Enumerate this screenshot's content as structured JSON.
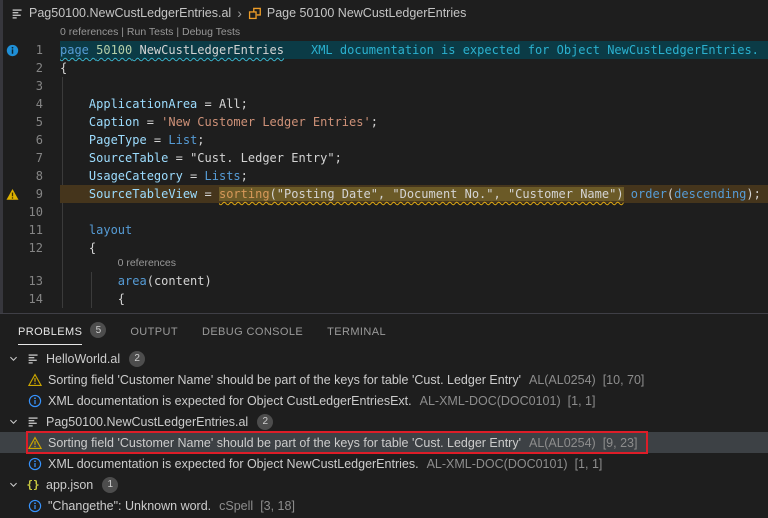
{
  "breadcrumb": {
    "file": "Pag50100.NewCustLedgerEntries.al",
    "separator": "›",
    "symbol": "Page 50100 NewCustLedgerEntries"
  },
  "editor": {
    "rows": [
      {
        "type": "lens",
        "text": "0 references | Run Tests | Debug Tests",
        "ind": 0
      },
      {
        "type": "code",
        "num": "1",
        "gutter": "info",
        "line": "info",
        "tokens": [
          {
            "t": "page ",
            "c": "kw sq-info"
          },
          {
            "t": "50100",
            "c": "cnum sq-info"
          },
          {
            "t": " ",
            "c": "plain sq-info"
          },
          {
            "t": "NewCustLedgerEntries",
            "c": "plain sq-info"
          }
        ],
        "hint": "XML documentation is expected for Object NewCustLedgerEntries."
      },
      {
        "type": "code",
        "num": "2",
        "tokens": [
          {
            "t": "{",
            "c": "plain"
          }
        ]
      },
      {
        "type": "code",
        "num": "3",
        "guides": [
          0
        ],
        "tokens": []
      },
      {
        "type": "code",
        "num": "4",
        "guides": [
          0
        ],
        "tokens": [
          {
            "t": "    ",
            "c": "plain"
          },
          {
            "t": "ApplicationArea",
            "c": "prop"
          },
          {
            "t": " = ",
            "c": "plain"
          },
          {
            "t": "All",
            "c": "plain"
          },
          {
            "t": ";",
            "c": "plain"
          }
        ]
      },
      {
        "type": "code",
        "num": "5",
        "guides": [
          0
        ],
        "tokens": [
          {
            "t": "    ",
            "c": "plain"
          },
          {
            "t": "Caption",
            "c": "prop"
          },
          {
            "t": " = ",
            "c": "plain"
          },
          {
            "t": "'New Customer Ledger Entries'",
            "c": "str"
          },
          {
            "t": ";",
            "c": "plain"
          }
        ]
      },
      {
        "type": "code",
        "num": "6",
        "guides": [
          0
        ],
        "tokens": [
          {
            "t": "    ",
            "c": "plain"
          },
          {
            "t": "PageType",
            "c": "prop"
          },
          {
            "t": " = ",
            "c": "plain"
          },
          {
            "t": "List",
            "c": "kw"
          },
          {
            "t": ";",
            "c": "plain"
          }
        ]
      },
      {
        "type": "code",
        "num": "7",
        "guides": [
          0
        ],
        "tokens": [
          {
            "t": "    ",
            "c": "plain"
          },
          {
            "t": "SourceTable",
            "c": "prop"
          },
          {
            "t": " = ",
            "c": "plain"
          },
          {
            "t": "\"Cust. Ledger Entry\"",
            "c": "plain"
          },
          {
            "t": ";",
            "c": "plain"
          }
        ]
      },
      {
        "type": "code",
        "num": "8",
        "guides": [
          0
        ],
        "tokens": [
          {
            "t": "    ",
            "c": "plain"
          },
          {
            "t": "UsageCategory",
            "c": "prop"
          },
          {
            "t": " = ",
            "c": "plain"
          },
          {
            "t": "Lists",
            "c": "kw"
          },
          {
            "t": ";",
            "c": "plain"
          }
        ]
      },
      {
        "type": "code",
        "num": "9",
        "gutter": "warn",
        "line": "warn",
        "tokens": [
          {
            "t": "    ",
            "c": "plain"
          },
          {
            "t": "SourceTableView",
            "c": "prop"
          },
          {
            "t": " = ",
            "c": "plain"
          },
          {
            "t": "sorting",
            "c": "alkw rng sq-warn"
          },
          {
            "t": "(\"Posting Date\", \"Document No.\", \"Customer Name\")",
            "c": "plain rng sq-warn"
          },
          {
            "t": " ",
            "c": "plain"
          },
          {
            "t": "order",
            "c": "kw"
          },
          {
            "t": "(",
            "c": "plain"
          },
          {
            "t": "descending",
            "c": "kw"
          },
          {
            "t": ");",
            "c": "plain"
          }
        ]
      },
      {
        "type": "code",
        "num": "10",
        "guides": [
          0
        ],
        "tokens": []
      },
      {
        "type": "code",
        "num": "11",
        "guides": [
          0
        ],
        "tokens": [
          {
            "t": "    ",
            "c": "plain"
          },
          {
            "t": "layout",
            "c": "kw"
          }
        ]
      },
      {
        "type": "code",
        "num": "12",
        "guides": [
          0
        ],
        "tokens": [
          {
            "t": "    {",
            "c": "plain"
          }
        ]
      },
      {
        "type": "lens",
        "text": "0 references",
        "ind": 8,
        "guides": [
          0
        ]
      },
      {
        "type": "code",
        "num": "13",
        "guides": [
          0,
          4
        ],
        "tokens": [
          {
            "t": "        ",
            "c": "plain"
          },
          {
            "t": "area",
            "c": "kw"
          },
          {
            "t": "(",
            "c": "plain"
          },
          {
            "t": "content",
            "c": "plain"
          },
          {
            "t": ")",
            "c": "plain"
          }
        ]
      },
      {
        "type": "code",
        "num": "14",
        "guides": [
          0,
          4
        ],
        "tokens": [
          {
            "t": "        {",
            "c": "plain"
          }
        ]
      }
    ]
  },
  "panel": {
    "tabs": [
      {
        "label": "PROBLEMS",
        "badge": "5",
        "active": true
      },
      {
        "label": "OUTPUT"
      },
      {
        "label": "DEBUG CONSOLE"
      },
      {
        "label": "TERMINAL"
      }
    ],
    "tree": [
      {
        "kind": "file",
        "icon": "al",
        "name": "HelloWorld.al",
        "badge": "2"
      },
      {
        "kind": "problem",
        "sev": "warn",
        "msg": "Sorting field 'Customer Name' should be part of the keys for table 'Cust. Ledger Entry'",
        "src": "AL(AL0254)",
        "pos": "[10, 70]"
      },
      {
        "kind": "problem",
        "sev": "info",
        "msg": "XML documentation is expected for Object CustLedgerEntriesExt.",
        "src": "AL-XML-DOC(DOC0101)",
        "pos": "[1, 1]"
      },
      {
        "kind": "file",
        "icon": "al",
        "name": "Pag50100.NewCustLedgerEntries.al",
        "badge": "2"
      },
      {
        "kind": "problem",
        "sev": "warn",
        "msg": "Sorting field 'Customer Name' should be part of the keys for table 'Cust. Ledger Entry'",
        "src": "AL(AL0254)",
        "pos": "[9, 23]",
        "selected": true,
        "annotated": true
      },
      {
        "kind": "problem",
        "sev": "info",
        "msg": "XML documentation is expected for Object NewCustLedgerEntries.",
        "src": "AL-XML-DOC(DOC0101)",
        "pos": "[1, 1]"
      },
      {
        "kind": "file",
        "icon": "json",
        "name": "app.json",
        "badge": "1"
      },
      {
        "kind": "problem",
        "sev": "info",
        "msg": "\"Changethe\": Unknown word.",
        "src": "cSpell",
        "pos": "[3, 18]"
      }
    ]
  },
  "colors": {
    "warning": "#cca700",
    "info": "#3794ff",
    "annotation_red": "#dd1d28",
    "inline_hint": "#2bb1cf",
    "warn_line_bg": "#45351c",
    "info_line_bg": "#0b3b46",
    "selection_bg": "#3d4145",
    "keyword": "#569cd6",
    "string": "#ce9178"
  }
}
